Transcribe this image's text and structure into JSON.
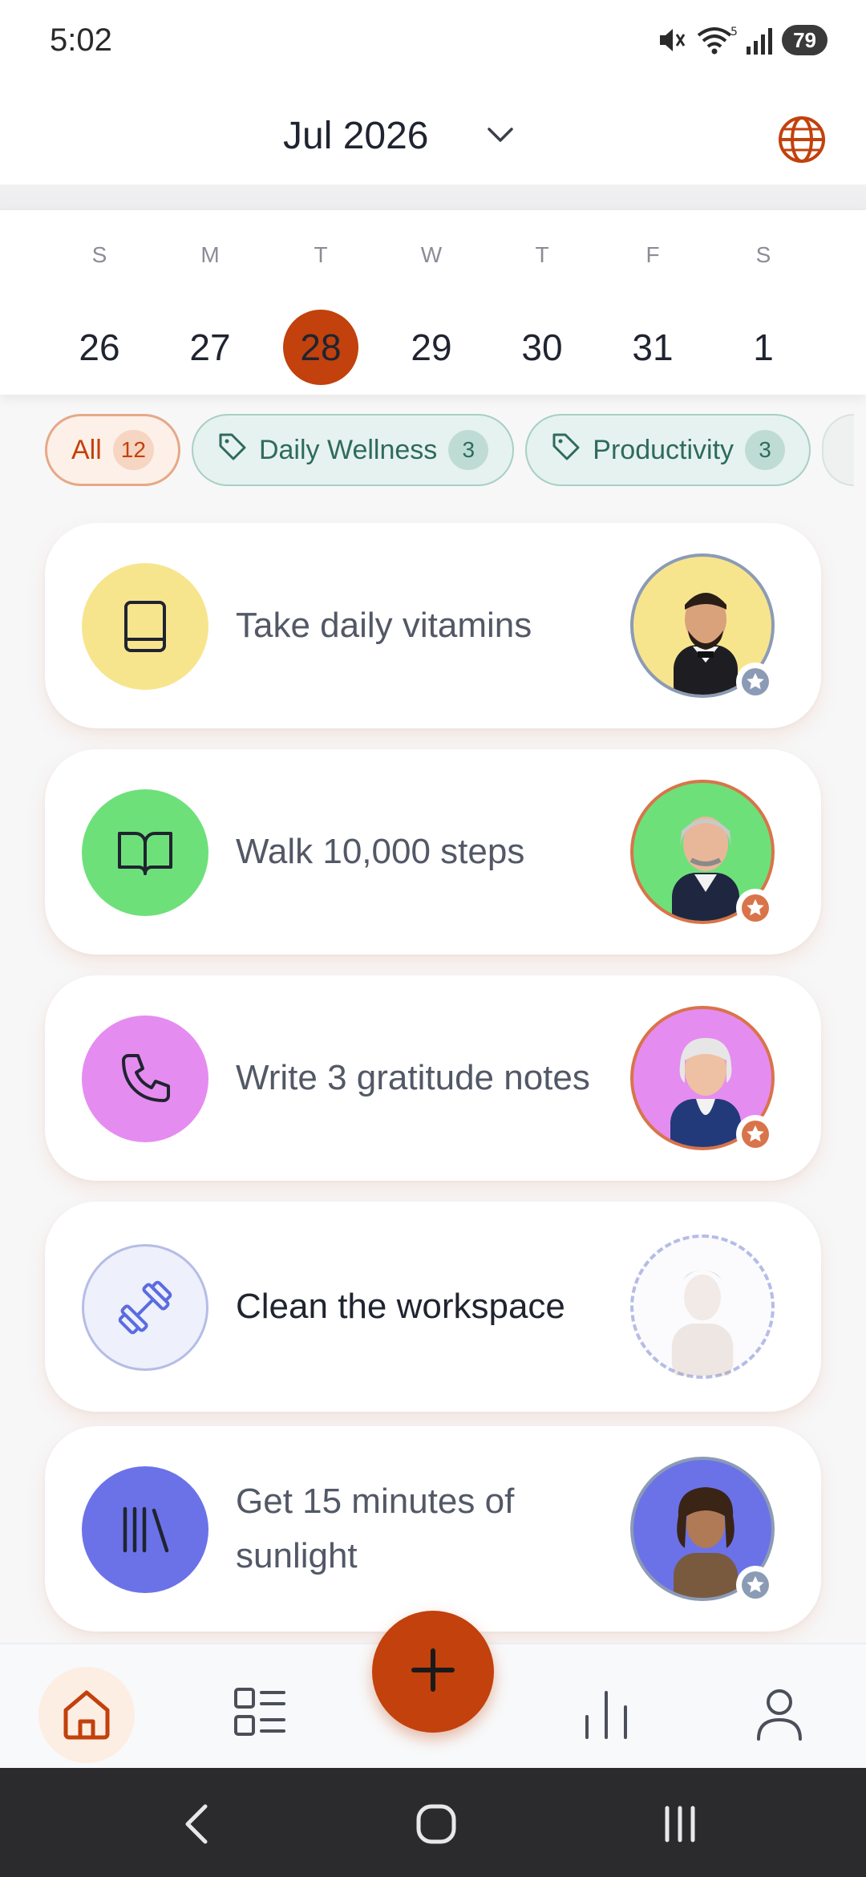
{
  "status_bar": {
    "time": "5:02",
    "battery": "79",
    "signal_extra": "5"
  },
  "header": {
    "month_label": "Jul 2026",
    "accent_color": "#c2410c"
  },
  "week": {
    "days": [
      {
        "letter": "S",
        "number": "26",
        "selected": false
      },
      {
        "letter": "M",
        "number": "27",
        "selected": false
      },
      {
        "letter": "T",
        "number": "28",
        "selected": true
      },
      {
        "letter": "W",
        "number": "29",
        "selected": false
      },
      {
        "letter": "T",
        "number": "30",
        "selected": false
      },
      {
        "letter": "F",
        "number": "31",
        "selected": false
      },
      {
        "letter": "S",
        "number": "1",
        "selected": false
      }
    ]
  },
  "filters": {
    "all": {
      "label": "All",
      "count": "12"
    },
    "tags": [
      {
        "label": "Daily Wellness",
        "count": "3"
      },
      {
        "label": "Productivity",
        "count": "3"
      }
    ]
  },
  "tasks": [
    {
      "title": "Take daily vitamins",
      "icon": "book-icon",
      "icon_bg": "#f7e58e",
      "avatar_bg": "#f7e58e",
      "badge_color": "#8c9bb5",
      "done": true
    },
    {
      "title": "Walk 10,000 steps",
      "icon": "open-book-icon",
      "icon_bg": "#6ee07a",
      "avatar_bg": "#6ee07a",
      "badge_color": "#d9744a",
      "done": true
    },
    {
      "title": "Write 3 gratitude notes",
      "icon": "phone-icon",
      "icon_bg": "#e58cf0",
      "avatar_bg": "#e58cf0",
      "badge_color": "#d9744a",
      "done": true
    },
    {
      "title": "Clean the workspace",
      "icon": "dumbbell-icon",
      "icon_bg": "#eef0fc",
      "avatar_bg": "#fbfbfd",
      "badge_color": "",
      "done": false
    },
    {
      "title": "Get 15 minutes of sunlight",
      "icon": "library-icon",
      "icon_bg": "#6b72e8",
      "avatar_bg": "#6b72e8",
      "badge_color": "#8c9bb5",
      "done": true
    }
  ],
  "bottom_nav": {
    "items": [
      "home-icon",
      "list-icon",
      "stats-icon",
      "profile-icon"
    ],
    "fab": "plus-icon"
  }
}
